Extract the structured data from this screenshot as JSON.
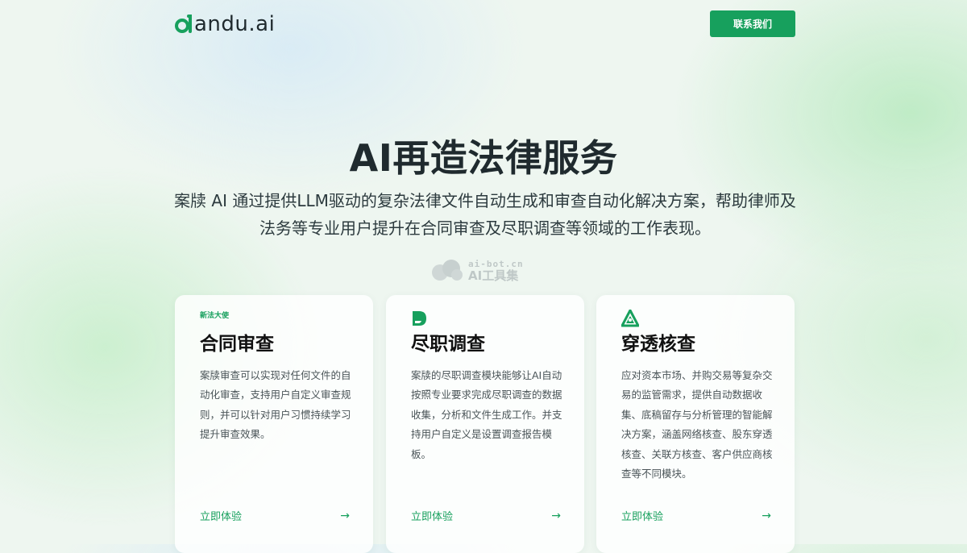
{
  "brand": {
    "logo_text": "andu.ai",
    "accent": "#17a05d",
    "text_dark": "#1f2a2e"
  },
  "header": {
    "contact_label": "联系我们"
  },
  "hero": {
    "title": "AI再造法律服务",
    "subtitle": "案牍 AI 通过提供LLM驱动的复杂法律文件自动生成和审查自动化解决方案，帮助律师及法务等专业用户提升在合同审查及尽职调查等领域的工作表现。"
  },
  "watermark": {
    "url": "ai-bot.cn",
    "name": "AI工具集"
  },
  "cards": [
    {
      "icon": "law-seal-icon",
      "icon_text": "新法大使",
      "title": "合同审查",
      "description": "案牍审查可以实现对任何文件的自动化审查，支持用户自定义审查规则，并可以针对用户习惯持续学习提升审查效果。",
      "link_label": "立即体验",
      "link_icon": "arrow-right-icon"
    },
    {
      "icon": "document-d-icon",
      "title": "尽职调查",
      "description": "案牍的尽职调查模块能够让AI自动按照专业要求完成尽职调查的数据收集，分析和文件生成工作。并支持用户自定义是设置调查报告模板。",
      "link_label": "立即体验",
      "link_icon": "arrow-right-icon"
    },
    {
      "icon": "triangle-network-icon",
      "title": "穿透核查",
      "description": "应对资本市场、并购交易等复杂交易的监管需求，提供自动数据收集、底稿留存与分析管理的智能解决方案，涵盖网络核查、股东穿透核查、关联方核查、客户供应商核查等不同模块。",
      "link_label": "立即体验",
      "link_icon": "arrow-right-icon"
    }
  ]
}
